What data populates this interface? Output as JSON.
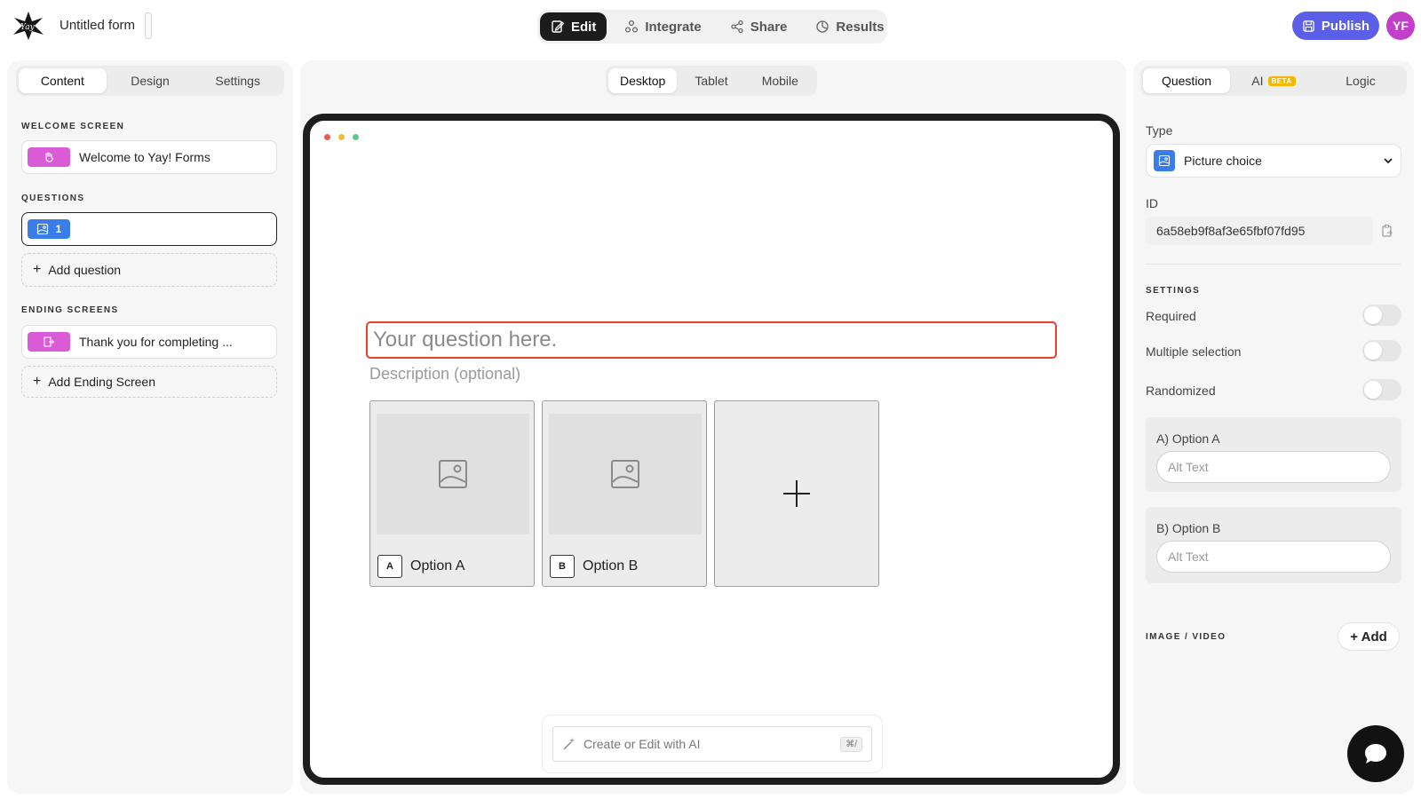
{
  "header": {
    "form_title": "Untitled form",
    "nav": [
      {
        "label": "Edit",
        "icon": "edit-icon",
        "active": true
      },
      {
        "label": "Integrate",
        "icon": "integrate-icon",
        "active": false
      },
      {
        "label": "Share",
        "icon": "share-icon",
        "active": false
      },
      {
        "label": "Results",
        "icon": "results-icon",
        "active": false
      }
    ],
    "publish_label": "Publish",
    "avatar_initials": "YF"
  },
  "left_panel": {
    "tabs": [
      "Content",
      "Design",
      "Settings"
    ],
    "active_tab": "Content",
    "welcome_label": "WELCOME SCREEN",
    "welcome_item": "Welcome to Yay! Forms",
    "questions_label": "QUESTIONS",
    "question_number": "1",
    "add_question": "Add question",
    "ending_label": "ENDING SCREENS",
    "ending_item": "Thank you for completing ...",
    "add_ending": "Add Ending Screen"
  },
  "center": {
    "device_tabs": [
      "Desktop",
      "Tablet",
      "Mobile"
    ],
    "active_device": "Desktop",
    "question_placeholder": "Your question here.",
    "description_placeholder": "Description (optional)",
    "choices": [
      {
        "key": "A",
        "label": "Option A"
      },
      {
        "key": "B",
        "label": "Option B"
      }
    ],
    "ai_placeholder": "Create or Edit with AI",
    "ai_shortcut": "⌘/"
  },
  "right_panel": {
    "tabs": [
      "Question",
      "AI",
      "Logic"
    ],
    "beta_badge": "BETA",
    "active_tab": "Question",
    "type_label": "Type",
    "type_value": "Picture choice",
    "id_label": "ID",
    "id_value": "6a58eb9f8af3e65fbf07fd95",
    "settings_label": "SETTINGS",
    "settings": [
      {
        "label": "Required",
        "enabled": false
      },
      {
        "label": "Multiple selection",
        "enabled": false
      },
      {
        "label": "Randomized",
        "enabled": false
      }
    ],
    "option_a_label": "A) Option A",
    "option_b_label": "B) Option B",
    "alt_text_placeholder": "Alt Text",
    "image_video_label": "IMAGE / VIDEO",
    "add_label": "+ Add"
  },
  "colors": {
    "accent": "#5b5ee6",
    "avatar": "#c13fc9",
    "welcome_badge": "#d95bd6",
    "question_badge": "#3b7de8",
    "highlight_border": "#e2412d"
  }
}
